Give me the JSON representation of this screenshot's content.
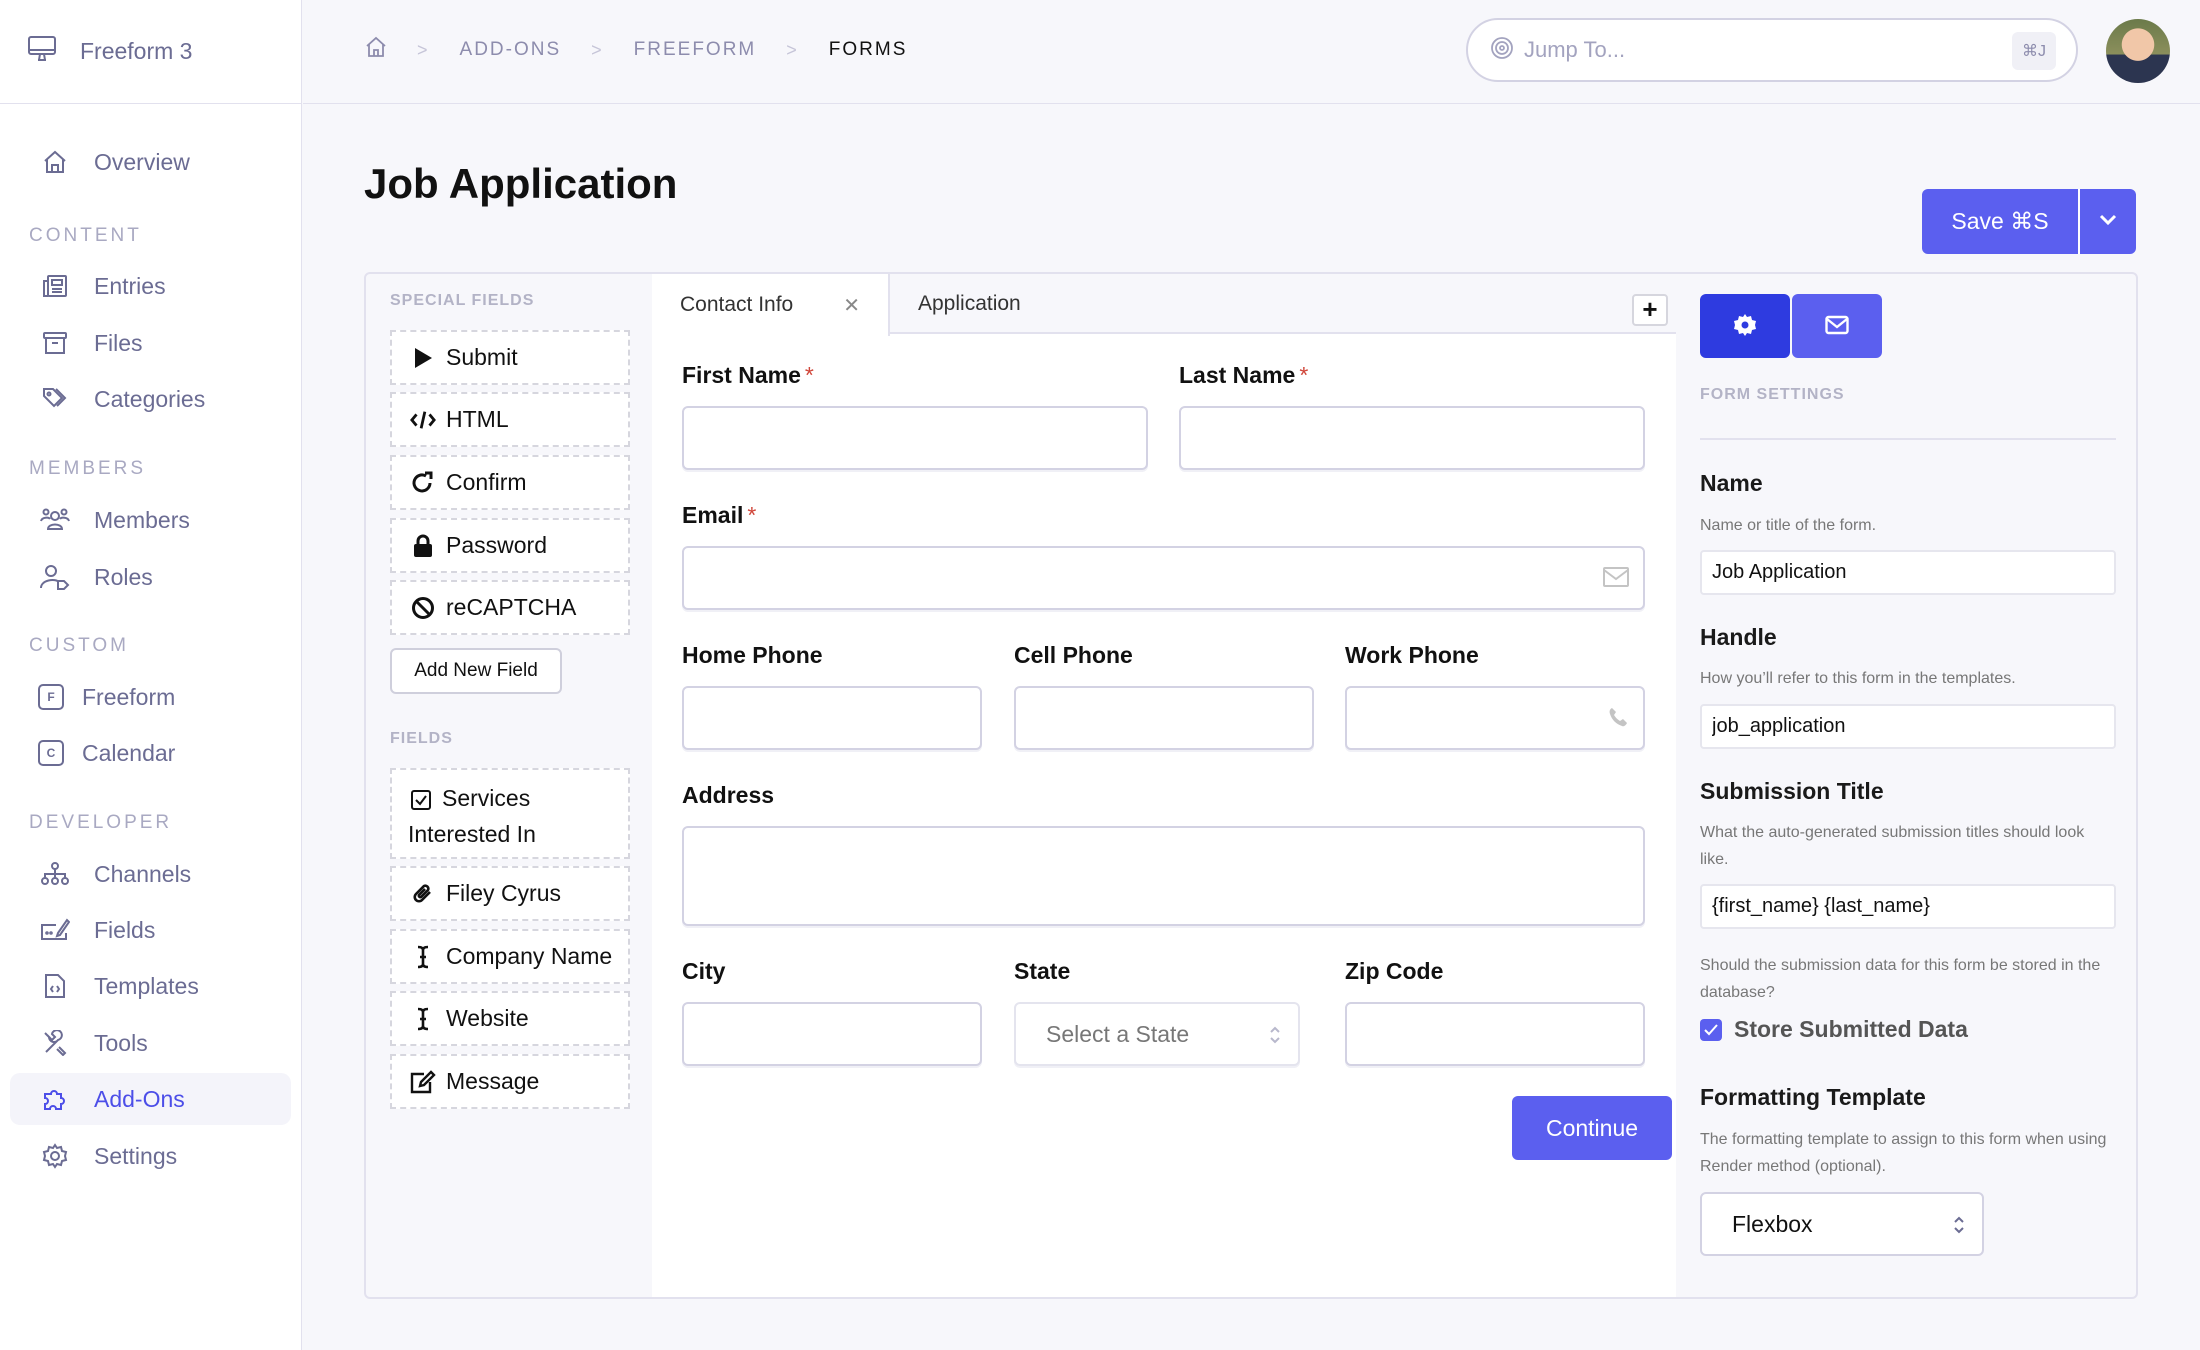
{
  "app": {
    "name": "Freeform 3"
  },
  "sidebar": {
    "groups": {
      "content": "CONTENT",
      "members": "MEMBERS",
      "custom": "CUSTOM",
      "developer": "DEVELOPER"
    },
    "items": [
      {
        "label": "Overview",
        "icon": "home-icon"
      },
      {
        "label": "Entries",
        "icon": "newspaper-icon"
      },
      {
        "label": "Files",
        "icon": "archive-icon"
      },
      {
        "label": "Categories",
        "icon": "tags-icon"
      },
      {
        "label": "Members",
        "icon": "users-icon"
      },
      {
        "label": "Roles",
        "icon": "user-tag-icon"
      },
      {
        "label": "Freeform",
        "icon": "letter-f-icon",
        "letter": "F"
      },
      {
        "label": "Calendar",
        "icon": "letter-c-icon",
        "letter": "C"
      },
      {
        "label": "Channels",
        "icon": "sitemap-icon"
      },
      {
        "label": "Fields",
        "icon": "field-edit-icon"
      },
      {
        "label": "Templates",
        "icon": "file-code-icon"
      },
      {
        "label": "Tools",
        "icon": "tools-icon"
      },
      {
        "label": "Add-Ons",
        "icon": "puzzle-icon",
        "active": true
      },
      {
        "label": "Settings",
        "icon": "gear-icon"
      }
    ]
  },
  "breadcrumb": [
    "ADD-ONS",
    "FREEFORM",
    "FORMS"
  ],
  "search": {
    "placeholder": "Jump To...",
    "shortcut": "⌘J"
  },
  "page": {
    "title": "Job Application"
  },
  "toolbar": {
    "save_label": "Save ⌘S"
  },
  "palette": {
    "special_label": "SPECIAL FIELDS",
    "special": [
      {
        "label": "Submit",
        "icon": "play-icon"
      },
      {
        "label": "HTML",
        "icon": "code-icon"
      },
      {
        "label": "Confirm",
        "icon": "redo-icon"
      },
      {
        "label": "Password",
        "icon": "lock-icon"
      },
      {
        "label": "reCAPTCHA",
        "icon": "ban-icon"
      }
    ],
    "add_field_label": "Add New Field",
    "fields_label": "FIELDS",
    "fields": [
      {
        "label": "Services Interested In",
        "icon": "checkbox-icon"
      },
      {
        "label": "Filey Cyrus",
        "icon": "paperclip-icon"
      },
      {
        "label": "Company Name",
        "icon": "text-cursor-icon"
      },
      {
        "label": "Website",
        "icon": "text-cursor-icon"
      },
      {
        "label": "Message",
        "icon": "edit-icon"
      }
    ]
  },
  "canvas": {
    "tabs": [
      {
        "label": "Contact Info",
        "active": true
      },
      {
        "label": "Application",
        "active": false
      }
    ],
    "fields": {
      "first_name": {
        "label": "First Name",
        "required": "*",
        "value": ""
      },
      "last_name": {
        "label": "Last Name",
        "required": "*",
        "value": ""
      },
      "email": {
        "label": "Email",
        "required": "*",
        "value": ""
      },
      "home_phone": {
        "label": "Home Phone",
        "value": ""
      },
      "cell_phone": {
        "label": "Cell Phone",
        "value": ""
      },
      "work_phone": {
        "label": "Work Phone",
        "value": ""
      },
      "address": {
        "label": "Address",
        "value": ""
      },
      "city": {
        "label": "City",
        "value": ""
      },
      "state": {
        "label": "State",
        "placeholder": "Select a State"
      },
      "zip": {
        "label": "Zip Code",
        "value": ""
      }
    },
    "continue_label": "Continue"
  },
  "settings": {
    "heading": "FORM SETTINGS",
    "name": {
      "label": "Name",
      "help": "Name or title of the form.",
      "value": "Job Application"
    },
    "handle": {
      "label": "Handle",
      "help": "How you’ll refer to this form in the templates.",
      "value": "job_application"
    },
    "submission_title": {
      "label": "Submission Title",
      "help": "What the auto-generated submission titles should look like.",
      "value": "{first_name} {last_name}"
    },
    "store": {
      "help": "Should the submission data for this form be stored in the database?",
      "label": "Store Submitted Data",
      "checked": true
    },
    "formatting": {
      "label": "Formatting Template",
      "help": "The formatting template to assign to this form when using Render method (optional).",
      "value": "Flexbox"
    }
  },
  "colors": {
    "accent": "#5b5fef",
    "accent_dark": "#2e3be0",
    "required": "#d0463a",
    "nav_text": "#6b6c93"
  }
}
